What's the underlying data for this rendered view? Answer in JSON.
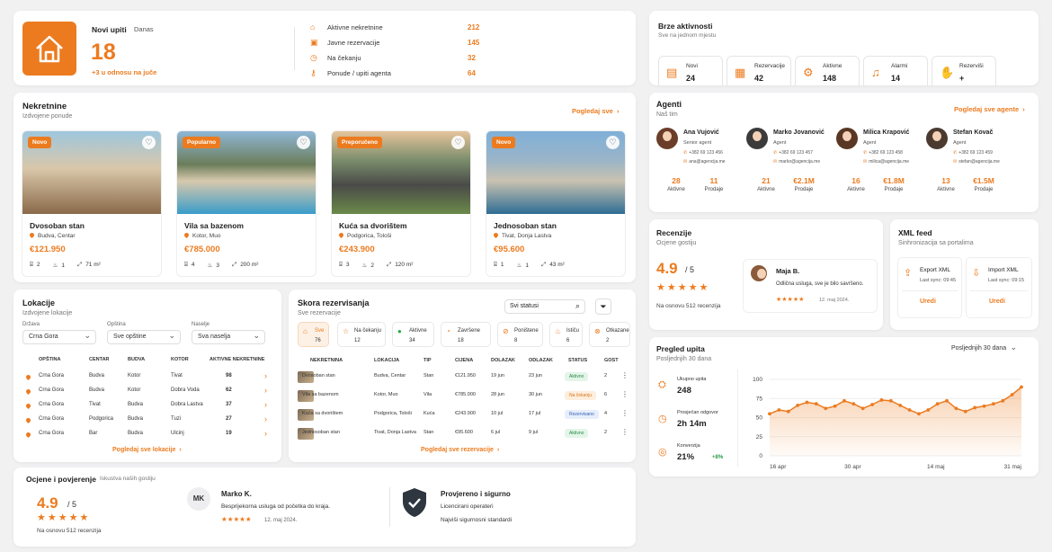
{
  "header": {
    "title": "Novi upiti",
    "period": "Danas",
    "count": "18",
    "delta": "+3 u odnosu na juče",
    "stats": [
      {
        "label": "Aktivne nekretnine",
        "value": "212"
      },
      {
        "label": "Javne rezervacije",
        "value": "145"
      },
      {
        "label": "Na čekanju",
        "value": "32"
      },
      {
        "label": "Ponude / upiti agenta",
        "value": "64"
      }
    ]
  },
  "quick": {
    "title": "Brze aktivnosti",
    "subtitle": "Sve na jednom mjestu",
    "items": [
      {
        "label": "Novi",
        "value": "24",
        "icon": "document-icon"
      },
      {
        "label": "Rezervacije",
        "value": "42",
        "icon": "calendar-icon"
      },
      {
        "label": "Aktivne",
        "value": "148",
        "icon": "gear-icon"
      },
      {
        "label": "Alarmi",
        "value": "14",
        "icon": "bell-icon"
      },
      {
        "label": "Rezerviši",
        "value": "+",
        "icon": "handshake-icon"
      }
    ]
  },
  "properties": {
    "title": "Nekretnine",
    "subtitle": "Izdvojene ponude",
    "view_all": "Pogledaj sve",
    "items": [
      {
        "badge": "Novo",
        "name": "Dvosoban stan",
        "location": "Budva, Centar",
        "price": "€121.950",
        "beds": "2",
        "baths": "1",
        "area": "71 m²",
        "gradient": "linear-gradient(180deg,#9ec7de 0%,#d9c7a9 45%,#8a6a4a 100%)"
      },
      {
        "badge": "Popularno",
        "name": "Vila sa bazenom",
        "location": "Kotor, Muo",
        "price": "€785.000",
        "beds": "4",
        "baths": "3",
        "area": "200 m²",
        "gradient": "linear-gradient(180deg,#8fb7d6 0%,#6b7d5a 40%,#d8c9ad 60%,#3a9cc9 100%)"
      },
      {
        "badge": "Preporučeno",
        "name": "Kuća sa dvorištem",
        "location": "Podgorica, Tološi",
        "price": "€243.900",
        "beds": "3",
        "baths": "2",
        "area": "120 m²",
        "gradient": "linear-gradient(180deg,#e6c49c 0%,#7a8d6c 35%,#4a4a48 65%,#6b8a4a 100%)"
      },
      {
        "badge": "Novo",
        "name": "Jednosoban stan",
        "location": "Tivat, Donja Lastva",
        "price": "€95.600",
        "beds": "1",
        "baths": "1",
        "area": "43 m²",
        "gradient": "linear-gradient(180deg,#7fb0d8 0%,#9ab4c8 35%,#c9c2b0 60%,#2f6d94 100%)"
      }
    ]
  },
  "agents": {
    "title": "Agenti",
    "subtitle": "Naš tim",
    "view_all": "Pogledaj sve agente",
    "active_label": "Aktivne",
    "sales_label": "Prodaje",
    "items": [
      {
        "name": "Ana Vujović",
        "role": "Senior agent",
        "phone": "+382 69 123 456",
        "email": "ana@agencija.me",
        "active": "28",
        "sales": "11"
      },
      {
        "name": "Marko Jovanović",
        "role": "Agent",
        "phone": "+382 69 123 457",
        "email": "marko@agencija.me",
        "active": "21",
        "sales": "€2.1M"
      },
      {
        "name": "Milica Krapović",
        "role": "Agent",
        "phone": "+382 69 123 458",
        "email": "milica@agencija.me",
        "active": "16",
        "sales": "€1.8M"
      },
      {
        "name": "Stefan Kovač",
        "role": "Agent",
        "phone": "+382 69 123 459",
        "email": "stefan@agencija.me",
        "active": "13",
        "sales": "€1.5M"
      }
    ]
  },
  "reviews": {
    "title": "Recenzije",
    "subtitle": "Ocjene gostiju",
    "score": "4.9",
    "of": "/ 5",
    "stars": "★★★★★",
    "count": "Na osnovu 512 recenzija",
    "reviewer": "Maja B.",
    "text": "Odlična usluga, sve je bilo savršeno.",
    "small_stars": "★★★★★",
    "date": "12. maj 2024."
  },
  "xml": {
    "title": "XML feed",
    "subtitle": "Sinhronizacija sa portalima",
    "export": "Export XML",
    "import": "Import XML",
    "export_sync": "Last sync: 09:45",
    "import_sync": "Last sync: 09:15",
    "edit": "Uredi"
  },
  "locations": {
    "title": "Lokacije",
    "subtitle": "Izdvojene lokacije",
    "filters": [
      {
        "label": "Država",
        "value": "Crna Gora"
      },
      {
        "label": "Opština",
        "value": "Sve opštine"
      },
      {
        "label": "Naselje",
        "value": "Sva naselja"
      }
    ],
    "columns": [
      "OPŠTINA",
      "CENTAR",
      "BUDVA",
      "KOTOR",
      "AKTIVNE NEKRETNINE"
    ],
    "rows": [
      [
        "Crna Gora",
        "Budva",
        "Kotor",
        "Tivat",
        "98"
      ],
      [
        "Crna Gora",
        "Budva",
        "Kotor",
        "Dobra Voda",
        "62"
      ],
      [
        "Crna Gora",
        "Tivat",
        "Budva",
        "Dobra Lastva",
        "37"
      ],
      [
        "Crna Gora",
        "Podgorica",
        "Budva",
        "Tuzi",
        "27"
      ],
      [
        "Crna Gora",
        "Bar",
        "Budva",
        "Ulcinj",
        "19"
      ]
    ],
    "view_all": "Pogledaj sve lokacije"
  },
  "bookings": {
    "title": "Skora rezervisanja",
    "subtitle": "Sve rezervacije",
    "filter": "Svi statusi",
    "chips": [
      {
        "label": "Sve",
        "value": "76"
      },
      {
        "label": "Na čekanju",
        "value": "12"
      },
      {
        "label": "Aktivne",
        "value": "34"
      },
      {
        "label": "Završene",
        "value": "18"
      },
      {
        "label": "Poništene",
        "value": "8"
      },
      {
        "label": "Ističu",
        "value": "6"
      },
      {
        "label": "Otkazane",
        "value": "2"
      }
    ],
    "columns": [
      "NEKRETNINA",
      "LOKACIJA",
      "TIP",
      "CIJENA",
      "DOLAZAK",
      "ODLAZAK",
      "STATUS",
      "GOST"
    ],
    "rows": [
      [
        "Dvosoban stan",
        "Budva, Centar",
        "Stan",
        "€121.950",
        "19 jun",
        "23 jun",
        "Aktivno",
        "2"
      ],
      [
        "Vila sa bazenom",
        "Kotor, Muo",
        "Vila",
        "€785.000",
        "28 jun",
        "30 jun",
        "Na čekanju",
        "6"
      ],
      [
        "Kuća sa dvorištem",
        "Podgorica, Tološi",
        "Kuća",
        "€243.900",
        "10 jul",
        "17 jul",
        "Rezervisano",
        "4"
      ],
      [
        "Jednosoban stan",
        "Tivat, Donja Lastva",
        "Stan",
        "€95.600",
        "6 jul",
        "9 jul",
        "Aktivno",
        "2"
      ]
    ],
    "view_all": "Pogledaj sve rezervacije"
  },
  "inquiries": {
    "title": "Pregled upita",
    "subtitle": "Posljednjih 30 dana",
    "range": "Posljednjih 30 dana",
    "kpis": [
      {
        "label": "Ukupno upita",
        "value": "248",
        "extra": ""
      },
      {
        "label": "Prosječan odgovor",
        "value": "2h 14m",
        "extra": ""
      },
      {
        "label": "Konverzija",
        "value": "21%",
        "extra": "+8%"
      }
    ]
  },
  "chart_data": {
    "type": "area",
    "x_labels": [
      "16 apr",
      "30 apr",
      "14 maj",
      "31 maj"
    ],
    "ylim": [
      0,
      100
    ],
    "y_ticks": [
      "0",
      "25",
      "50",
      "75",
      "100"
    ],
    "values": [
      55,
      60,
      58,
      66,
      70,
      68,
      62,
      65,
      72,
      68,
      62,
      67,
      73,
      72,
      66,
      60,
      55,
      60,
      68,
      72,
      62,
      58,
      63,
      65,
      68,
      72,
      80,
      90
    ],
    "color": "#ec7b1f"
  },
  "trust": {
    "title": "Ocjene i povjerenje",
    "subtitle": "Iskustva naših gostiju",
    "score": "4.9",
    "of": "/ 5",
    "stars": "★★★★★",
    "count": "Na osnovu 512 recenzija",
    "initials": "MK",
    "reviewer": "Marko K.",
    "text": "Besprijekorna usluga od početka do kraja.",
    "small_stars": "★★★★★",
    "date": "12. maj 2024.",
    "verified_title": "Provjereno i sigurno",
    "verified_1": "Licencirani operateri",
    "verified_2": "Najviši sigurnosni standardi"
  }
}
